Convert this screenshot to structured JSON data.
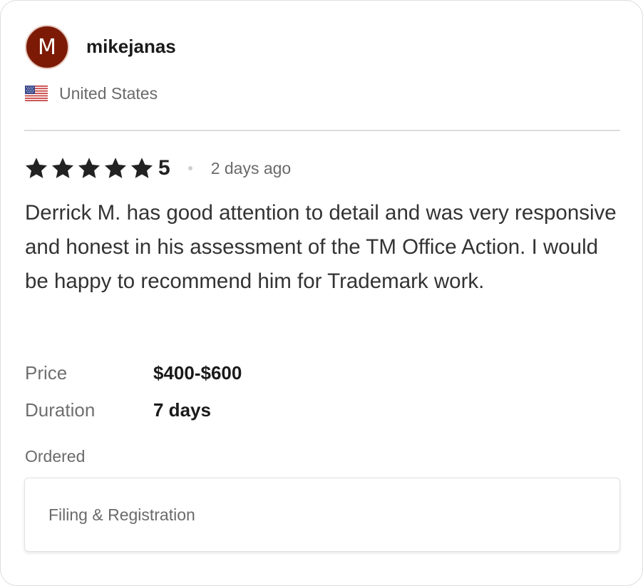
{
  "reviewer": {
    "avatar_initial": "M",
    "avatar_color": "#7c1a06",
    "username": "mikejanas",
    "country": "United States",
    "flag_icon": "us-flag-icon"
  },
  "review": {
    "rating": 5,
    "rating_display": "5",
    "star_icon": "star-icon",
    "time_ago": "2 days ago",
    "text": "Derrick M. has good attention to detail and was very responsive and honest in his assessment of the TM Office Action. I would be happy to recommend him for Trademark work."
  },
  "details": {
    "price_label": "Price",
    "price_value": "$400-$600",
    "duration_label": "Duration",
    "duration_value": "7 days"
  },
  "ordered": {
    "label": "Ordered",
    "item": "Filing & Registration"
  }
}
